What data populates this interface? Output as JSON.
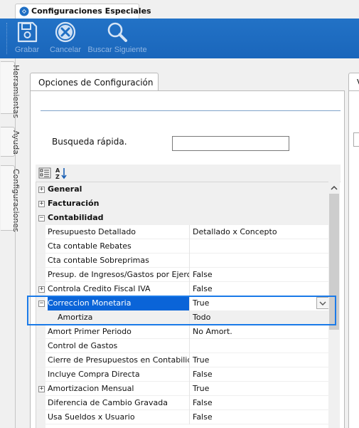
{
  "window_tab": {
    "title": "Configuraciones Especiales",
    "icon": "settings-shield-icon"
  },
  "toolbar": {
    "buttons": [
      {
        "label": "Grabar",
        "icon": "floppy-disk-icon"
      },
      {
        "label": "Cancelar",
        "icon": "cancel-circle-icon"
      },
      {
        "label": "Buscar Siguiente",
        "icon": "magnifier-icon"
      }
    ]
  },
  "side_tabs": [
    "Herramientas",
    "Ayuda",
    "Configuraciones"
  ],
  "panel": {
    "tab_label": "Opciones de Configuración",
    "right_tab_label": "V",
    "search_label": "Busqueda rápida.",
    "search_value": ""
  },
  "grid_toolbar": {
    "icons": [
      "categorized-view-icon",
      "alphabetical-sort-icon"
    ]
  },
  "property_grid": {
    "rows": [
      {
        "type": "category",
        "expander": "+",
        "name": "General",
        "value": ""
      },
      {
        "type": "category",
        "expander": "+",
        "name": "Facturación",
        "value": ""
      },
      {
        "type": "category",
        "expander": "−",
        "name": "Contabilidad",
        "value": ""
      },
      {
        "type": "property",
        "expander": "",
        "name": "Presupuesto Detallado",
        "value": "Detallado x Concepto"
      },
      {
        "type": "property",
        "expander": "",
        "name": "Cta contable Rebates",
        "value": ""
      },
      {
        "type": "property",
        "expander": "",
        "name": "Cta contable Sobreprimas",
        "value": ""
      },
      {
        "type": "property",
        "expander": "",
        "name": "Presup. de Ingresos/Gastos por Ejercicio",
        "value": "False"
      },
      {
        "type": "property",
        "expander": "+",
        "name": "Controla Credito Fiscal IVA",
        "value": "False"
      },
      {
        "type": "selected",
        "expander": "−",
        "name": "Correccion Monetaria",
        "value": "True"
      },
      {
        "type": "subproperty",
        "expander": "",
        "name": "Amortiza",
        "value": "Todo"
      },
      {
        "type": "property",
        "expander": "",
        "name": "Amort Primer Periodo",
        "value": "No Amort."
      },
      {
        "type": "property",
        "expander": "",
        "name": "Control de Gastos",
        "value": ""
      },
      {
        "type": "property",
        "expander": "",
        "name": "Cierre de Presupuestos en Contabilidad",
        "value": "True"
      },
      {
        "type": "property",
        "expander": "",
        "name": "Incluye Compra Directa",
        "value": "False"
      },
      {
        "type": "property",
        "expander": "+",
        "name": "Amortizacion Mensual",
        "value": "True"
      },
      {
        "type": "property",
        "expander": "",
        "name": "Diferencia de Cambio Gravada",
        "value": "False"
      },
      {
        "type": "property",
        "expander": "",
        "name": "Usa Sueldos x Usuario",
        "value": "False"
      }
    ]
  },
  "colors": {
    "toolbar_blue": "#1f6fc4",
    "selection_blue": "#0a64d8",
    "highlight_border": "#1a7ae8"
  }
}
